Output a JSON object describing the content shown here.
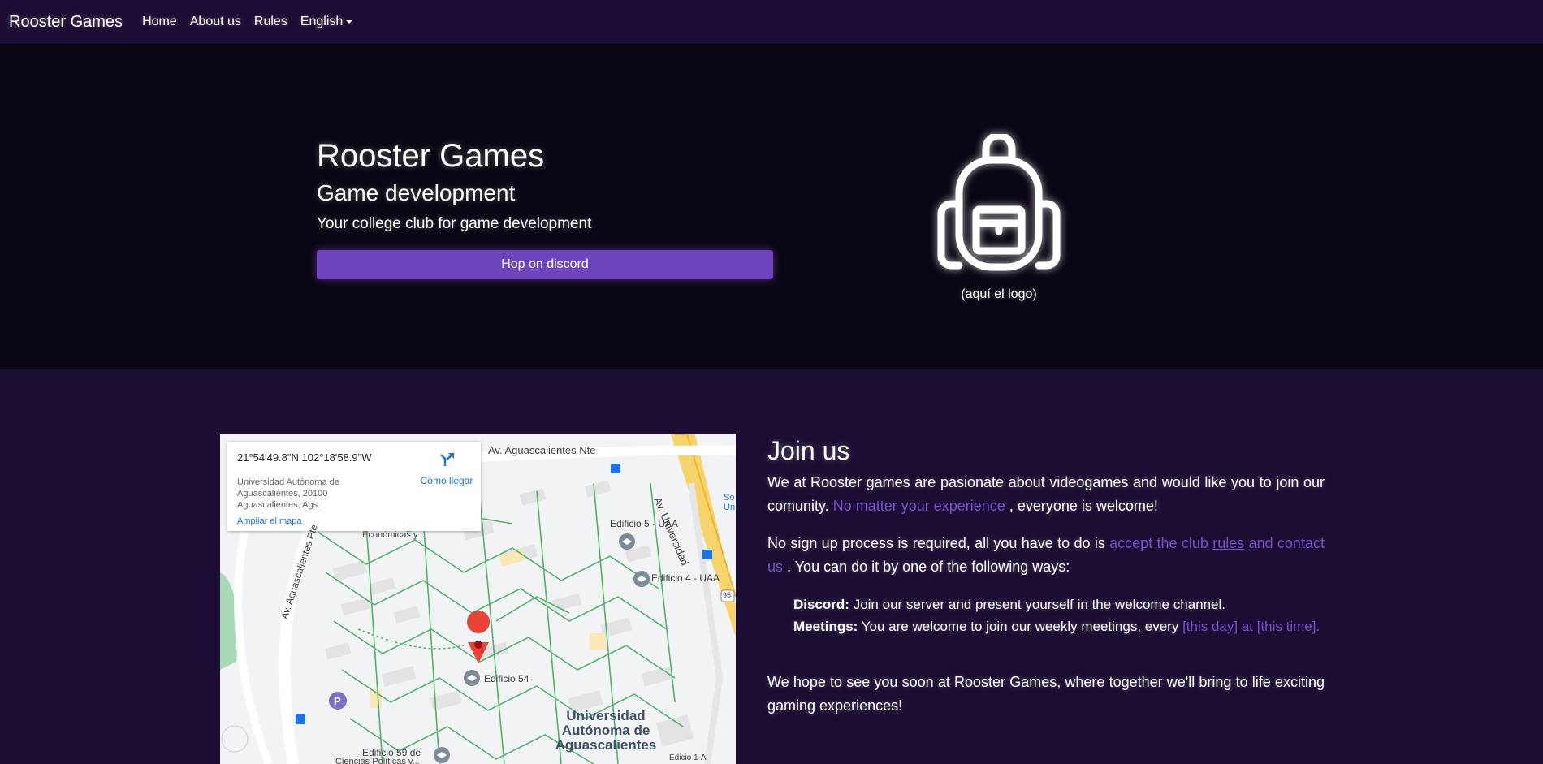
{
  "nav": {
    "brand": "Rooster Games",
    "links": [
      "Home",
      "About us",
      "Rules"
    ],
    "language": "English"
  },
  "hero": {
    "title": "Rooster Games",
    "subtitle": "Game development",
    "lead": "Your college club for game development",
    "button": "Hop on discord",
    "logo_caption": "(aquí el logo)",
    "logo_icon": "backpack-icon"
  },
  "map": {
    "coords": "21°54'49.8\"N 102°18'58.9\"W",
    "address": "Universidad Autónoma de Aguascalientes, 20100 Aguascalientes, Ags.",
    "directions": "Cómo llegar",
    "enlarge": "Ampliar el mapa",
    "labels": {
      "street_north": "Av. Aguascalientes Nte",
      "street_univ": "Av. Universidad",
      "street_west": "Av. Aguascalientes Pte.",
      "ed5": "Edificio 5 - UAA",
      "ed4": "Edificio 4 - UAA",
      "ed54": "Edificio 54",
      "ed59": "Edificio 59 de",
      "ed59b": "Ciencias Políticas y...",
      "econ": "Económicas y...",
      "uaa": "Universidad Autónoma de Aguascalientes",
      "ed1a": "Edicio 1-A",
      "so": "So",
      "un": "Un",
      "route": "95"
    }
  },
  "join": {
    "title": "Join us",
    "p1_a": "We at Rooster games are pasionate about videogames and would like you to join our comunity.",
    "p1_accent": "No matter your experience",
    "p1_b": ", everyone is welcome!",
    "p2_a": "No sign up process is required, all you have to do is",
    "p2_accent1": "accept the club",
    "p2_link": "rules",
    "p2_accent2": "and contact us",
    "p2_b": ". You can do it by one of the following ways:",
    "discord_label": "Discord:",
    "discord_text": "Join our server and present yourself in the welcome channel.",
    "meetings_label": "Meetings:",
    "meetings_text": "You are welcome to join our weekly meetings, every",
    "meetings_accent": "[this day] at [this time].",
    "p3": "We hope to see you soon at Rooster Games, where together we'll bring to life exciting gaming experiences!"
  }
}
